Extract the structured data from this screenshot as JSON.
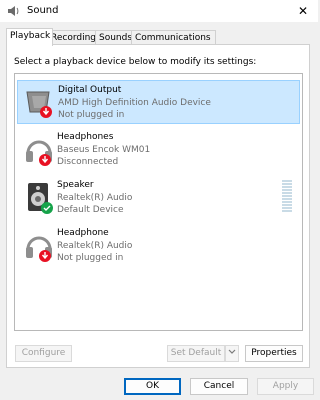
{
  "window": {
    "title": "Sound",
    "close_glyph": "✕"
  },
  "tabs": [
    {
      "label": "Playback",
      "active": true
    },
    {
      "label": "Recording"
    },
    {
      "label": "Sounds"
    },
    {
      "label": "Communications"
    }
  ],
  "playback": {
    "instruction": "Select a playback device below to modify its settings:",
    "devices": [
      {
        "name": "Digital Output",
        "driver": "AMD High Definition Audio Device",
        "status": "Not plugged in",
        "icon": "digital-output-icon",
        "badge": "unplugged"
      },
      {
        "name": "Headphones",
        "driver": "Baseus Encok WM01",
        "status": "Disconnected",
        "icon": "headphones-icon",
        "badge": "unplugged"
      },
      {
        "name": "Speaker",
        "driver": "Realtek(R) Audio",
        "status": "Default Device",
        "icon": "speaker-icon",
        "badge": "default"
      },
      {
        "name": "Headphone",
        "driver": "Realtek(R) Audio",
        "status": "Not plugged in",
        "icon": "headphones-icon",
        "badge": "unplugged"
      }
    ],
    "buttons": {
      "configure": "Configure",
      "set_default": "Set Default",
      "properties": "Properties"
    }
  },
  "footer": {
    "ok": "OK",
    "cancel": "Cancel",
    "apply": "Apply"
  },
  "colors": {
    "accent": "#0067c0",
    "selection": "#cce8ff",
    "badge_red": "#e81123",
    "badge_green": "#16a34a"
  }
}
